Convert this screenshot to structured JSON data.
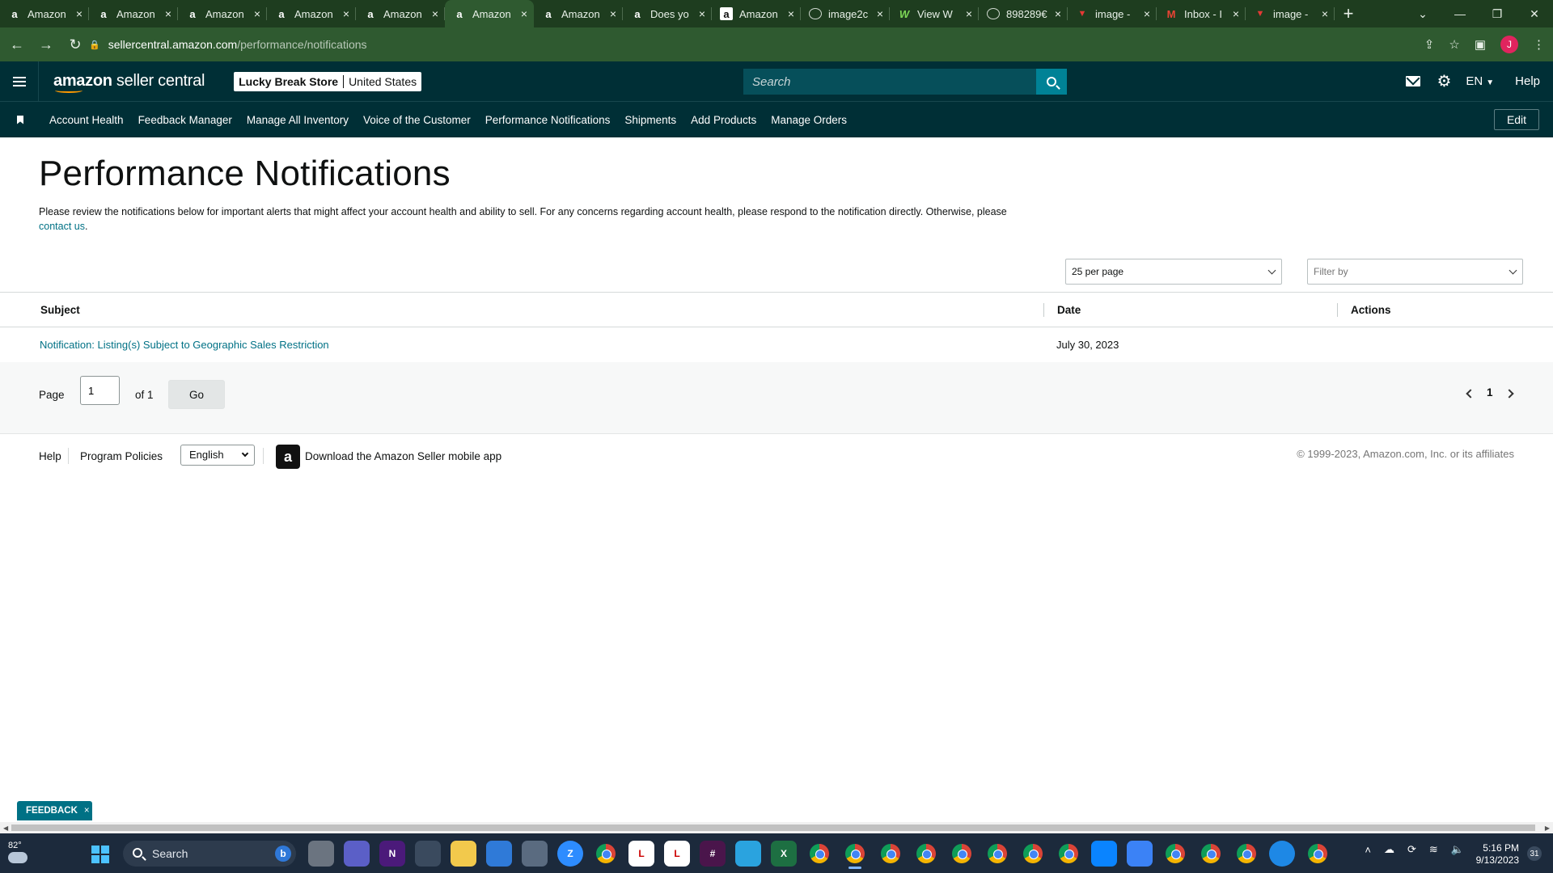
{
  "browser": {
    "tabs": [
      {
        "title": "Amazon",
        "favicon": "amazon-icon",
        "active": false
      },
      {
        "title": "Amazon",
        "favicon": "amazon-icon",
        "active": false
      },
      {
        "title": "Amazon",
        "favicon": "amazon-icon",
        "active": false
      },
      {
        "title": "Amazon",
        "favicon": "amazon-icon",
        "active": false
      },
      {
        "title": "Amazon",
        "favicon": "amazon-icon",
        "active": false
      },
      {
        "title": "Amazon",
        "favicon": "amazon-icon",
        "active": true
      },
      {
        "title": "Amazon",
        "favicon": "amazon-icon",
        "active": false
      },
      {
        "title": "Does yo",
        "favicon": "amazon-icon",
        "active": false
      },
      {
        "title": "Amazon",
        "favicon": "amazon-box-icon",
        "active": false
      },
      {
        "title": "image2c",
        "favicon": "globe-icon",
        "active": false
      },
      {
        "title": "View W",
        "favicon": "w-icon",
        "active": false
      },
      {
        "title": "898289€",
        "favicon": "globe-icon",
        "active": false
      },
      {
        "title": "image -",
        "favicon": "red-icon",
        "active": false
      },
      {
        "title": "Inbox - I",
        "favicon": "gmail-icon",
        "active": false
      },
      {
        "title": "image -",
        "favicon": "red-icon",
        "active": false
      }
    ],
    "url_host": "sellercentral.amazon.com",
    "url_path": "/performance/notifications",
    "profile_initial": "J"
  },
  "header": {
    "logo_bold": "amazon",
    "logo_rest": " seller central",
    "store_name": "Lucky Break Store",
    "marketplace": "United States",
    "search_placeholder": "Search",
    "language": "EN",
    "help": "Help"
  },
  "nav": {
    "items": [
      "Account Health",
      "Feedback Manager",
      "Manage All Inventory",
      "Voice of the Customer",
      "Performance Notifications",
      "Shipments",
      "Add Products",
      "Manage Orders"
    ],
    "edit": "Edit"
  },
  "main": {
    "title": "Performance Notifications",
    "intro": "Please review the notifications below for important alerts that might affect your account health and ability to sell. For any concerns regarding account health, please respond to the notification directly. Otherwise, please ",
    "contact_link": "contact us",
    "intro_end": ".",
    "per_page": "25 per page",
    "filter_placeholder": "Filter by",
    "columns": {
      "subject": "Subject",
      "date": "Date",
      "actions": "Actions"
    },
    "rows": [
      {
        "subject": "Notification: Listing(s) Subject to Geographic Sales Restriction",
        "date": "July 30, 2023",
        "actions": ""
      }
    ],
    "pagination": {
      "page_label": "Page",
      "page_value": "1",
      "of_label": "of 1",
      "go": "Go",
      "current": "1"
    }
  },
  "footer": {
    "help": "Help",
    "policies": "Program Policies",
    "language": "English",
    "app_text": "Download the Amazon Seller mobile app",
    "copyright": "© 1999-2023, Amazon.com, Inc. or its affiliates"
  },
  "feedback": {
    "label": "FEEDBACK",
    "close": "×"
  },
  "taskbar": {
    "temp": "82°",
    "search": "Search",
    "time": "5:16 PM",
    "date": "9/13/2023",
    "notifications": "31"
  },
  "colors": {
    "header_bg": "#002f36",
    "link": "#007185",
    "search_btn": "#008296",
    "browser_frame": "#2f5a30"
  }
}
